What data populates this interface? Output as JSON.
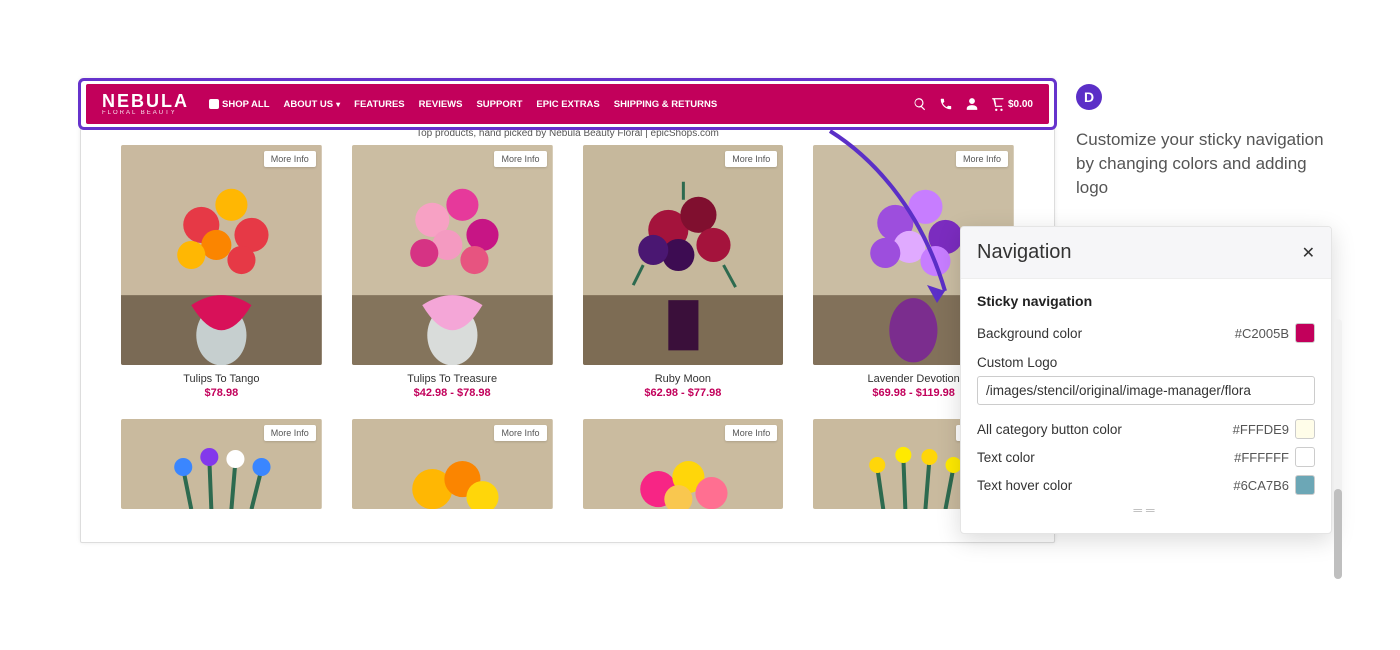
{
  "callout": {
    "letter": "D",
    "text": "Customize your sticky navigation by changing colors and adding logo"
  },
  "nav": {
    "logo_main": "NEBULA",
    "logo_sub": "FLORAL BEAUTY",
    "items": [
      "SHOP ALL",
      "ABOUT US",
      "FEATURES",
      "REVIEWS",
      "SUPPORT",
      "EPIC EXTRAS",
      "SHIPPING & RETURNS"
    ],
    "cart_total": "$0.00"
  },
  "tagline": "Top products, hand picked by Nebula Beauty Floral | epicShops.com",
  "more_label": "More Info",
  "products": [
    {
      "name": "Tulips To Tango",
      "price": "$78.98"
    },
    {
      "name": "Tulips To Treasure",
      "price": "$42.98 - $78.98"
    },
    {
      "name": "Ruby Moon",
      "price": "$62.98 - $77.98"
    },
    {
      "name": "Lavender Devotion",
      "price": "$69.98 - $119.98"
    }
  ],
  "panel": {
    "title": "Navigation",
    "section": "Sticky navigation",
    "bg_label": "Background color",
    "bg_hex": "#C2005B",
    "logo_label": "Custom Logo",
    "logo_value": "/images/stencil/original/image-manager/flora",
    "cat_label": "All category button color",
    "cat_hex": "#FFFDE9",
    "text_label": "Text color",
    "text_hex": "#FFFFFF",
    "hover_label": "Text hover color",
    "hover_hex": "#6CA7B6"
  }
}
